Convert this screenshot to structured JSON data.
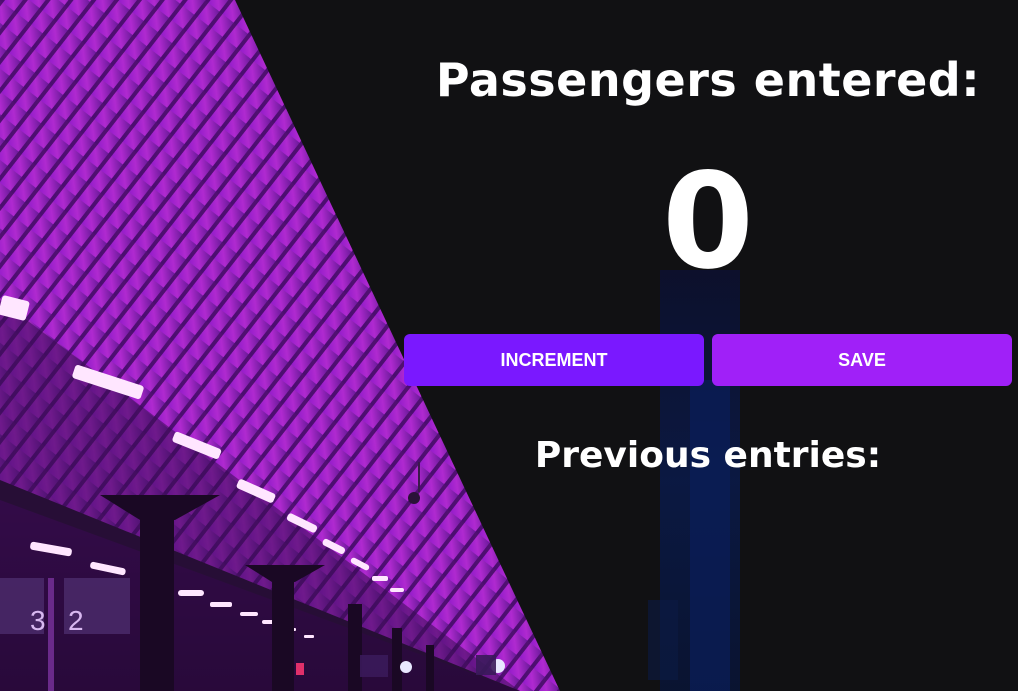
{
  "app": {
    "heading": "Passengers entered:",
    "count": "0",
    "previous_heading": "Previous entries:",
    "previous_entries": ""
  },
  "buttons": {
    "increment_label": "Increment",
    "save_label": "Save"
  },
  "colors": {
    "page_background": "#111113",
    "increment_button": "#7a18ff",
    "save_button": "#a020f8",
    "text": "#ffffff",
    "platform_neon": "#b020d8"
  }
}
